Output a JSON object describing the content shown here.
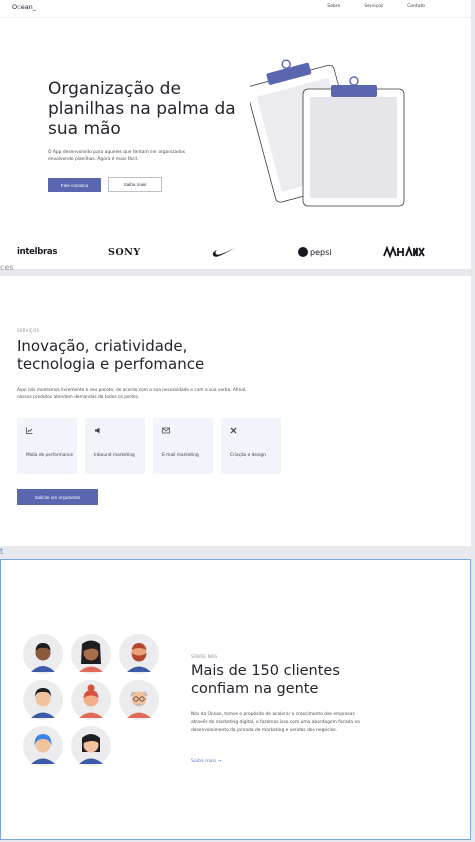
{
  "header": {
    "logo_prefix": "O",
    "logo_accent": "c",
    "logo_suffix": "ean_",
    "nav": [
      "Sobre",
      "Serviços",
      "Contato"
    ]
  },
  "hero": {
    "title": "Organização de planilhas na palma da sua mão",
    "description": "O App desenvolvido para aqueles que tentam ser organizados envolvendo planilhas. Agora é mais fácil.",
    "primary_button": "Fale conosco",
    "secondary_button": "Saiba mais",
    "illustration": "clipboards-illustration"
  },
  "brands": {
    "intelbras": "intelbras",
    "sony": "SONY",
    "nike": "nike-logo",
    "pepsi": "pepsi",
    "last": "nike-logo-wordmark"
  },
  "labels": {
    "section_tag_1": "ces",
    "section_tag_2": "t"
  },
  "services": {
    "kicker": "SERVIÇOS",
    "title": "Inovação, criatividade, tecnologia e perfomance",
    "description": "Aqui nós montamos livremente o seu pacote, de acordo com a sua necessidade e com a sua verba. Afinal, nossos produtos atendem demandas de todos os portes.",
    "cards": [
      {
        "icon": "📈",
        "icon_name": "chart-icon",
        "label": "Mídia de performance"
      },
      {
        "icon": "📢",
        "icon_name": "megaphone-icon",
        "label": "Inbound marketing"
      },
      {
        "icon": "✉",
        "icon_name": "mail-icon",
        "label": "E-mail marketing"
      },
      {
        "icon": "✖",
        "icon_name": "design-icon",
        "label": "Criação e design"
      }
    ],
    "button": "Solicite um orçamento"
  },
  "about": {
    "kicker": "SOBRE NÓS",
    "title": "Mais de 150 clientes confiam na gente",
    "description": "Nós da Ocean, temos o propósito de acelerar o crescimento das empresas através do marketing digital, e fazemos isso com uma abordagem focada no desenvolvimento da jornada de marketing e vendas dos negócios.",
    "link": "Saiba mais →"
  },
  "colors": {
    "accent": "#5a67b0",
    "card_bg": "#f2f4fb",
    "link": "#5a7fd0",
    "frame_border": "#7aa7dc"
  }
}
